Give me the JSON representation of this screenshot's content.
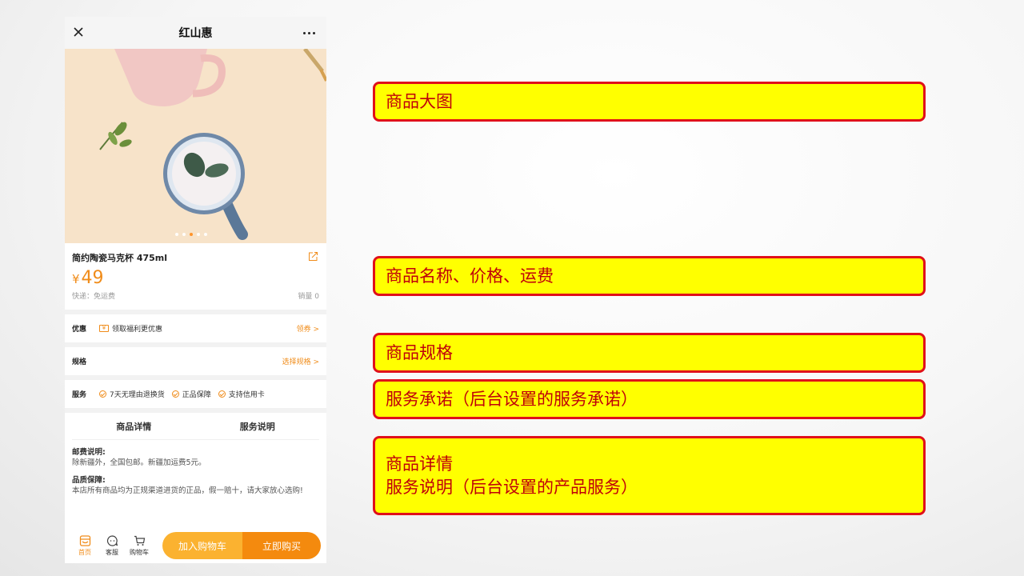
{
  "nav": {
    "title": "红山惠"
  },
  "product": {
    "name": "简约陶瓷马克杯 475ml",
    "currency": "¥",
    "price": "49",
    "shipping": "快递：免运费",
    "sales": "销量 0"
  },
  "coupon": {
    "label": "优惠",
    "text": "领取福利更优惠",
    "action": "领券 >",
    "icon": "¥"
  },
  "spec": {
    "label": "规格",
    "action": "选择规格 >"
  },
  "service": {
    "label": "服务",
    "items": [
      "7天无理由退换货",
      "正品保障",
      "支持信用卡"
    ]
  },
  "tabs": [
    "商品详情",
    "服务说明"
  ],
  "detail": [
    {
      "heading": "邮费说明:",
      "text": "除新疆外，全国包邮。新疆加运费5元。"
    },
    {
      "heading": "品质保障:",
      "text": "本店所有商品均为正规渠道进货的正品，假一赔十，请大家放心选购!"
    }
  ],
  "bottom_bar": {
    "icons": [
      "首页",
      "客服",
      "购物车"
    ],
    "add_cart": "加入购物车",
    "buy_now": "立即购买"
  },
  "annotations": [
    [
      "商品大图"
    ],
    [
      "商品名称、价格、运费"
    ],
    [
      "商品规格"
    ],
    [
      "服务承诺（后台设置的服务承诺）"
    ],
    [
      "商品详情",
      "服务说明（后台设置的产品服务）"
    ]
  ],
  "colors": {
    "accent": "#f08c1a",
    "annotation_bg": "#ffff00",
    "annotation_border": "#e0101a"
  }
}
